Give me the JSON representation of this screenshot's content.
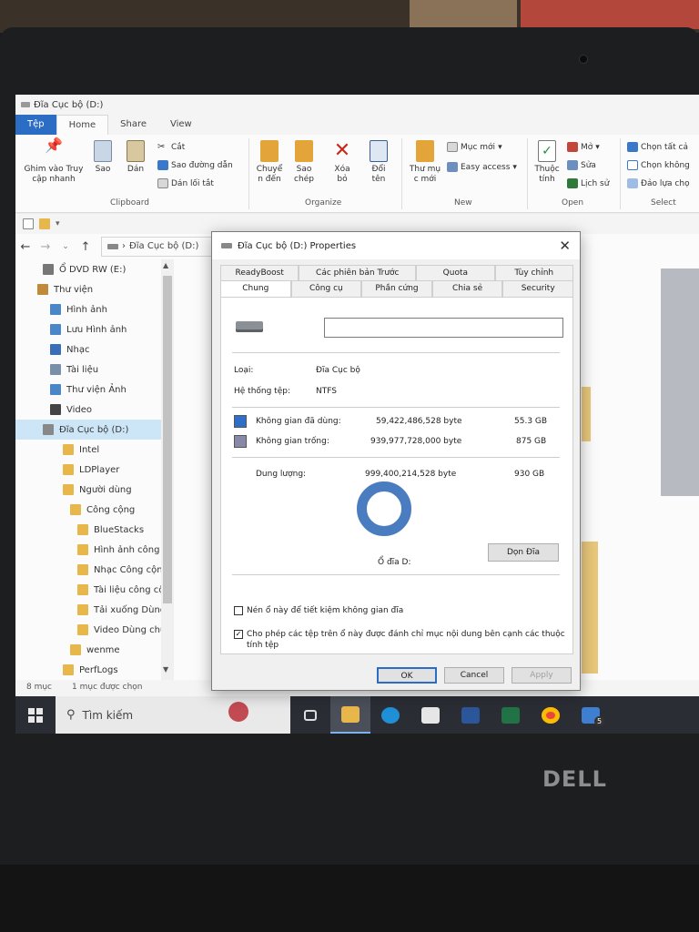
{
  "explorer": {
    "window_title": "Đĩa Cục bộ (D:)",
    "menu": [
      "Tệp",
      "Home",
      "Share",
      "View"
    ],
    "ribbon": {
      "pin": "Ghim vào Truy cập nhanh",
      "copy": "Sao",
      "paste": "Dán",
      "cut": "Cắt",
      "copy_path": "Sao đường dẫn",
      "paste_shortcut": "Dán lối tắt",
      "move_to": "Chuyể n đến",
      "copy_to": "Sao chép",
      "delete": "Xóa bỏ",
      "rename": "Đổi tên",
      "new_folder": "Thư mụ c mới",
      "new_item": "Mục mới",
      "easy_access": "Easy access",
      "properties": "Thuộc tính",
      "open": "Mở",
      "edit": "Sửa",
      "history": "Lịch sử",
      "select_all": "Chọn tất cả",
      "select_none": "Chọn không",
      "invert": "Đảo lựa chọ",
      "groups": [
        "Clipboard",
        "Organize",
        "New",
        "Open",
        "Select"
      ]
    },
    "address": {
      "path": "Đĩa Cục bộ (D:)",
      "back": "←",
      "forward": "→",
      "up": "↑",
      "chevron": "⌄"
    },
    "nav_items": [
      {
        "label": "Ổ DVD RW (E:)",
        "icon": "dvd-drive-icon"
      },
      {
        "label": "Thư viện",
        "icon": "library-icon"
      },
      {
        "label": "Hình ảnh",
        "icon": "pictures-icon"
      },
      {
        "label": "Lưu Hình ảnh",
        "icon": "pictures-icon"
      },
      {
        "label": "Nhạc",
        "icon": "music-icon"
      },
      {
        "label": "Tài liệu",
        "icon": "documents-icon"
      },
      {
        "label": "Thư viện Ảnh",
        "icon": "pictures-icon"
      },
      {
        "label": "Video",
        "icon": "video-icon"
      },
      {
        "label": "Đĩa Cục bộ (D:)",
        "icon": "drive-icon"
      },
      {
        "label": "Intel",
        "icon": "folder-icon"
      },
      {
        "label": "LDPlayer",
        "icon": "folder-icon"
      },
      {
        "label": "Người dùng",
        "icon": "folder-icon"
      },
      {
        "label": "Công cộng",
        "icon": "folder-icon"
      },
      {
        "label": "BlueStacks",
        "icon": "folder-icon"
      },
      {
        "label": "Hình ảnh công cộ",
        "icon": "folder-icon"
      },
      {
        "label": "Nhạc Công cộng",
        "icon": "folder-icon"
      },
      {
        "label": "Tài liệu công cộng",
        "icon": "folder-icon"
      },
      {
        "label": "Tải xuống Dùng ch",
        "icon": "folder-icon"
      },
      {
        "label": "Video Dùng chung",
        "icon": "folder-icon"
      },
      {
        "label": "wenme",
        "icon": "folder-icon"
      },
      {
        "label": "PerfLogs",
        "icon": "folder-icon"
      }
    ],
    "status": {
      "count": "8 mục",
      "selected": "1 mục được chọn"
    }
  },
  "taskbar": {
    "search_placeholder": "Tìm kiếm",
    "apps": [
      "task-view-icon",
      "file-explorer-icon",
      "edge-icon",
      "store-icon",
      "word-icon",
      "excel-icon",
      "chrome-icon",
      "mail-icon"
    ],
    "mail_badge": "5"
  },
  "dialog": {
    "title": "Đĩa Cục bộ (D:) Properties",
    "close": "✕",
    "tabs_row1": [
      "ReadyBoost",
      "Các phiên bản Trước",
      "Quota",
      "Tùy chỉnh"
    ],
    "tabs_row2": [
      "Chung",
      "Công cụ",
      "Phần cứng",
      "Chia sẻ",
      "Security"
    ],
    "name_value": "",
    "type_label": "Loại:",
    "type_value": "Đĩa Cục bộ",
    "fs_label": "Hệ thống tệp:",
    "fs_value": "NTFS",
    "used_label": "Không gian đã dùng:",
    "used_bytes": "59,422,486,528 byte",
    "used_gb": "55.3 GB",
    "free_label": "Không gian trống:",
    "free_bytes": "939,977,728,000 byte",
    "free_gb": "875 GB",
    "capacity_label": "Dung lượng:",
    "capacity_bytes": "999,400,214,528 byte",
    "capacity_gb": "930 GB",
    "drive_label": "Ổ đĩa D:",
    "cleanup_button": "Dọn Đĩa",
    "compress_label": "Nén ổ này để tiết kiệm không gian đĩa",
    "index_label": "Cho phép các tệp trên ổ này được đánh chỉ mục nội dung bên cạnh các thuộc tính tệp",
    "compress_checked": false,
    "index_checked": true,
    "ok": "OK",
    "cancel": "Cancel",
    "apply": "Apply"
  },
  "colors": {
    "used": "#2f6fc7",
    "free": "#8a88a8",
    "accent": "#2b6cc4"
  },
  "hardware": {
    "brand": "DELL"
  }
}
